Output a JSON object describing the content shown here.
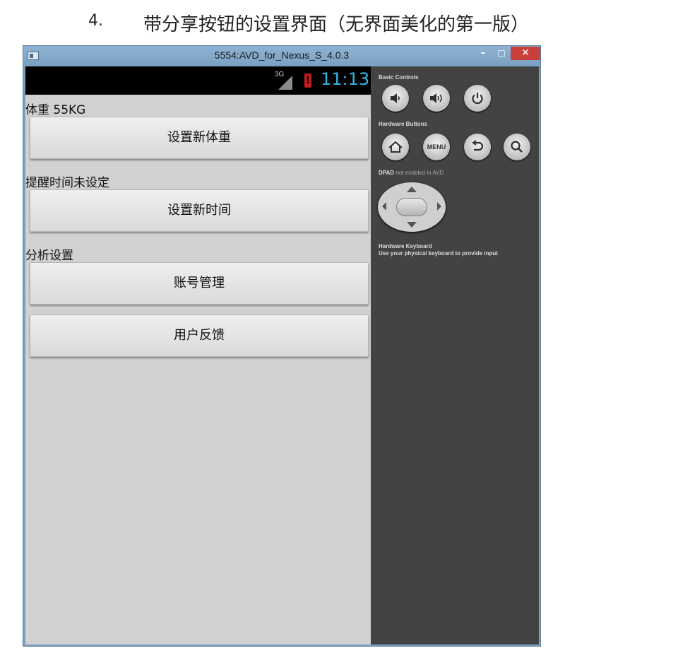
{
  "document": {
    "number": "4.",
    "heading": "带分享按钮的设置界面（无界面美化的第一版）"
  },
  "window": {
    "title": "5554:AVD_for_Nexus_S_4.0.3",
    "minimize_glyph": "–",
    "maximize_glyph": "□",
    "close_glyph": "✕"
  },
  "statusbar": {
    "network": "3G",
    "time": "11:13"
  },
  "app": {
    "weight_label": "体重 55KG",
    "set_weight_button": "设置新体重",
    "reminder_label": "提醒时间未设定",
    "set_time_button": "设置新时间",
    "analysis_label": "分析设置",
    "account_button": "账号管理",
    "feedback_button": "用户反馈"
  },
  "controls": {
    "basic_controls_title": "Basic Controls",
    "volume_down_icon": "speaker-low-icon",
    "volume_up_icon": "speaker-high-icon",
    "power_icon": "power-icon",
    "hardware_buttons_title": "Hardware Buttons",
    "home_icon": "home-icon",
    "menu_label": "MENU",
    "back_icon": "back-icon",
    "search_icon": "search-icon",
    "dpad_title": "DPAD",
    "dpad_note": "not enabled in AVD",
    "keyboard_title": "Hardware Keyboard",
    "keyboard_note": "Use your physical keyboard to provide input"
  },
  "colors": {
    "clock": "#33b5e5",
    "close_button": "#c7403a",
    "titlebar": "#7aa0c2",
    "screen_bg": "#d1d1d1",
    "panel_bg": "#434343"
  }
}
